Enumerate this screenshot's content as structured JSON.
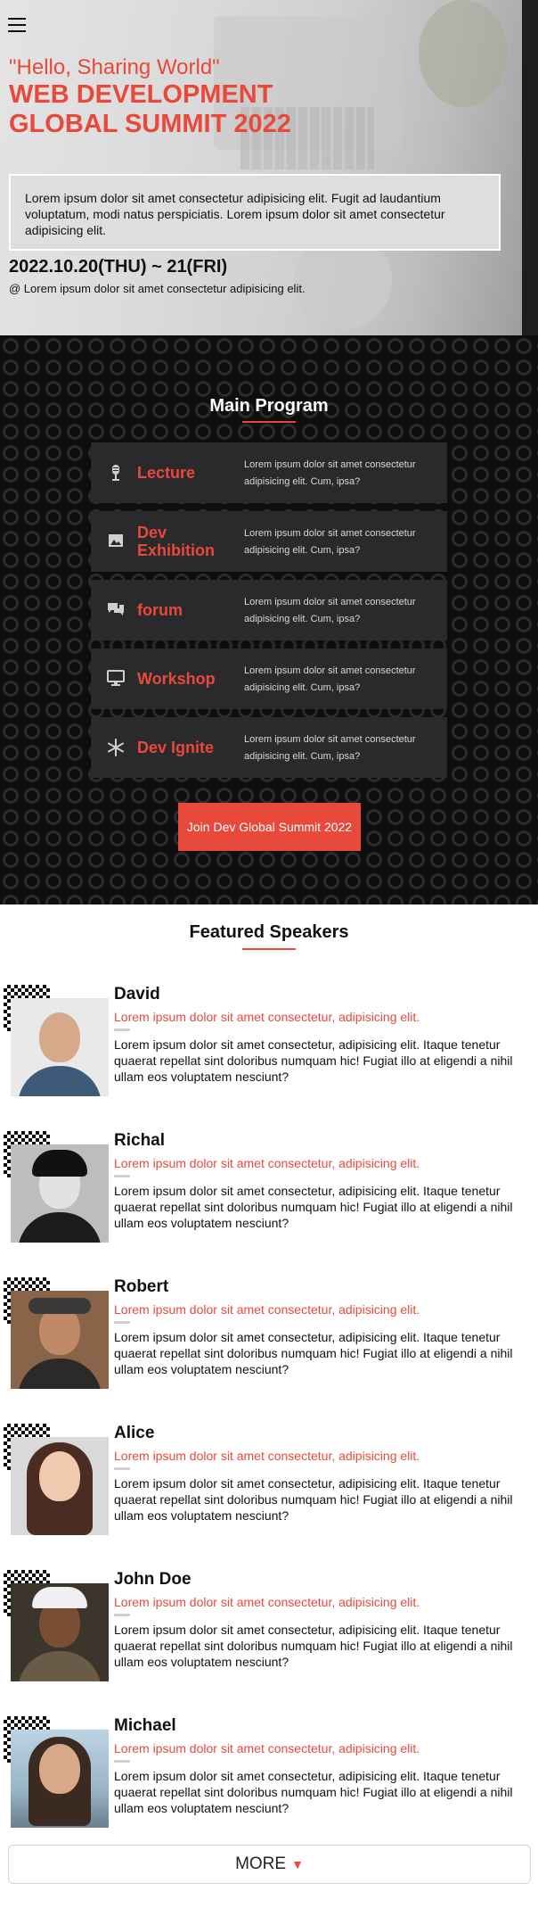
{
  "hero": {
    "quote": "\"Hello, Sharing World\"",
    "title": "WEB DEVELOPMENT GLOBAL SUMMIT 2022",
    "intro": "Lorem ipsum dolor sit amet consectetur adipisicing elit. Fugit ad laudantium voluptatum, modi natus perspiciatis. Lorem ipsum dolor sit amet consectetur adipisicing elit.",
    "date": "2022.10.20(THU) ~ 21(FRI)",
    "location": "@ Lorem ipsum dolor sit amet consectetur adipisicing elit."
  },
  "icons": {
    "menu": "hamburger-menu-icon",
    "lecture": "microphone-icon",
    "exhibition": "image-icon",
    "forum": "chat-icon",
    "workshop": "monitor-icon",
    "ignite": "snowflake-icon",
    "more": "caret-down-icon"
  },
  "program": {
    "title": "Main Program",
    "items": [
      {
        "label": "Lecture",
        "desc": "Lorem ipsum dolor sit amet consectetur adipisicing elit. Cum, ipsa?"
      },
      {
        "label": "Dev Exhibition",
        "desc": "Lorem ipsum dolor sit amet consectetur adipisicing elit. Cum, ipsa?"
      },
      {
        "label": "forum",
        "desc": "Lorem ipsum dolor sit amet consectetur adipisicing elit. Cum, ipsa?"
      },
      {
        "label": "Workshop",
        "desc": "Lorem ipsum dolor sit amet consectetur adipisicing elit. Cum, ipsa?"
      },
      {
        "label": "Dev Ignite",
        "desc": "Lorem ipsum dolor sit amet consectetur adipisicing elit. Cum, ipsa?"
      }
    ],
    "cta": "Join Dev Global Summit 2022"
  },
  "speakers": {
    "title": "Featured Speakers",
    "items": [
      {
        "name": "David",
        "subtitle": "Lorem ipsum dolor sit amet consectetur, adipisicing elit.",
        "bio": "Lorem ipsum dolor sit amet consectetur, adipisicing elit. Itaque tenetur quaerat repellat sint doloribus numquam hic! Fugiat illo at eligendi a nihil ullam eos voluptatem nesciunt?"
      },
      {
        "name": "Richal",
        "subtitle": "Lorem ipsum dolor sit amet consectetur, adipisicing elit.",
        "bio": "Lorem ipsum dolor sit amet consectetur, adipisicing elit. Itaque tenetur quaerat repellat sint doloribus numquam hic! Fugiat illo at eligendi a nihil ullam eos voluptatem nesciunt?"
      },
      {
        "name": "Robert",
        "subtitle": "Lorem ipsum dolor sit amet consectetur, adipisicing elit.",
        "bio": "Lorem ipsum dolor sit amet consectetur, adipisicing elit. Itaque tenetur quaerat repellat sint doloribus numquam hic! Fugiat illo at eligendi a nihil ullam eos voluptatem nesciunt?"
      },
      {
        "name": "Alice",
        "subtitle": "Lorem ipsum dolor sit amet consectetur, adipisicing elit.",
        "bio": "Lorem ipsum dolor sit amet consectetur, adipisicing elit. Itaque tenetur quaerat repellat sint doloribus numquam hic! Fugiat illo at eligendi a nihil ullam eos voluptatem nesciunt?"
      },
      {
        "name": "John Doe",
        "subtitle": "Lorem ipsum dolor sit amet consectetur, adipisicing elit.",
        "bio": "Lorem ipsum dolor sit amet consectetur, adipisicing elit. Itaque tenetur quaerat repellat sint doloribus numquam hic! Fugiat illo at eligendi a nihil ullam eos voluptatem nesciunt?"
      },
      {
        "name": "Michael",
        "subtitle": "Lorem ipsum dolor sit amet consectetur, adipisicing elit.",
        "bio": "Lorem ipsum dolor sit amet consectetur, adipisicing elit. Itaque tenetur quaerat repellat sint doloribus numquam hic! Fugiat illo at eligendi a nihil ullam eos voluptatem nesciunt?"
      }
    ],
    "more_label": "MORE"
  },
  "colors": {
    "accent": "#e8493b",
    "dark_bg": "#0e0e0e",
    "card_bg": "#2a2a2c"
  }
}
